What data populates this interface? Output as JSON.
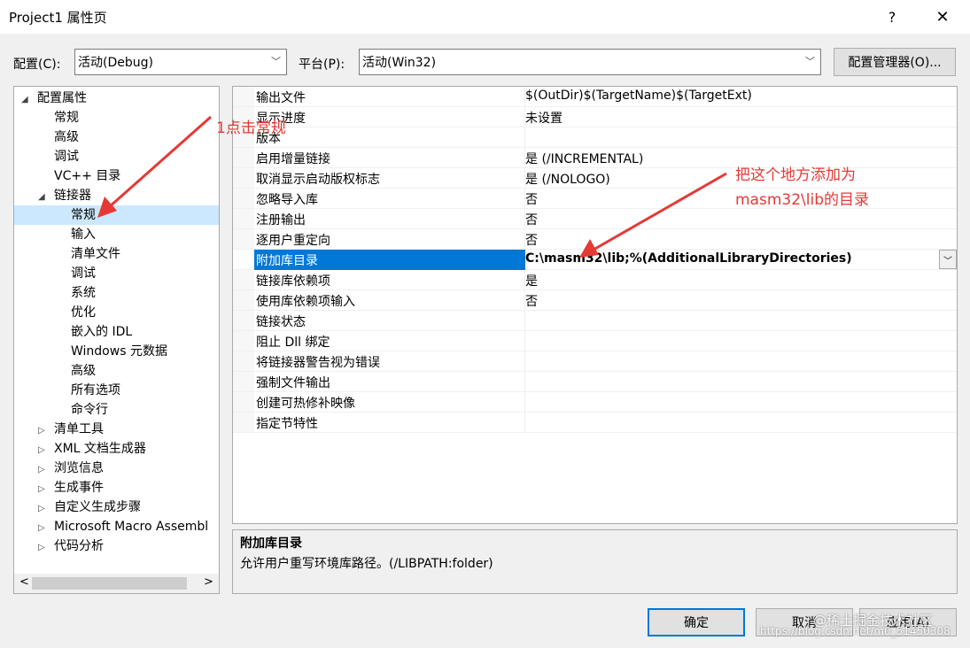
{
  "window": {
    "title": "Project1 属性页",
    "help": "?",
    "close": "✕"
  },
  "config": {
    "label": "配置(C):",
    "value": "活动(Debug)"
  },
  "platform": {
    "label": "平台(P):",
    "value": "活动(Win32)"
  },
  "config_manager_button": "配置管理器(O)...",
  "tree": [
    {
      "label": "配置属性",
      "toggle": "◢",
      "level": 0
    },
    {
      "label": "常规",
      "toggle": "",
      "level": 1
    },
    {
      "label": "高级",
      "toggle": "",
      "level": 1
    },
    {
      "label": "调试",
      "toggle": "",
      "level": 1
    },
    {
      "label": "VC++ 目录",
      "toggle": "",
      "level": 1
    },
    {
      "label": "链接器",
      "toggle": "◢",
      "level": 1
    },
    {
      "label": "常规",
      "toggle": "",
      "level": 2,
      "selected": true
    },
    {
      "label": "输入",
      "toggle": "",
      "level": 2
    },
    {
      "label": "清单文件",
      "toggle": "",
      "level": 2
    },
    {
      "label": "调试",
      "toggle": "",
      "level": 2
    },
    {
      "label": "系统",
      "toggle": "",
      "level": 2
    },
    {
      "label": "优化",
      "toggle": "",
      "level": 2
    },
    {
      "label": "嵌入的 IDL",
      "toggle": "",
      "level": 2
    },
    {
      "label": "Windows 元数据",
      "toggle": "",
      "level": 2
    },
    {
      "label": "高级",
      "toggle": "",
      "level": 2
    },
    {
      "label": "所有选项",
      "toggle": "",
      "level": 2
    },
    {
      "label": "命令行",
      "toggle": "",
      "level": 2
    },
    {
      "label": "清单工具",
      "toggle": "▷",
      "level": 1
    },
    {
      "label": "XML 文档生成器",
      "toggle": "▷",
      "level": 1
    },
    {
      "label": "浏览信息",
      "toggle": "▷",
      "level": 1
    },
    {
      "label": "生成事件",
      "toggle": "▷",
      "level": 1
    },
    {
      "label": "自定义生成步骤",
      "toggle": "▷",
      "level": 1
    },
    {
      "label": "Microsoft Macro Assembl",
      "toggle": "▷",
      "level": 1
    },
    {
      "label": "代码分析",
      "toggle": "▷",
      "level": 1
    }
  ],
  "tree_scroll": {
    "left": "<",
    "right": ">"
  },
  "properties": [
    {
      "key": "输出文件",
      "value": "$(OutDir)$(TargetName)$(TargetExt)"
    },
    {
      "key": "显示进度",
      "value": "未设置"
    },
    {
      "key": "版本",
      "value": ""
    },
    {
      "key": "启用增量链接",
      "value": "是 (/INCREMENTAL)"
    },
    {
      "key": "取消显示启动版权标志",
      "value": "是 (/NOLOGO)"
    },
    {
      "key": "忽略导入库",
      "value": "否"
    },
    {
      "key": "注册输出",
      "value": "否"
    },
    {
      "key": "逐用户重定向",
      "value": "否"
    },
    {
      "key": "附加库目录",
      "value": "C:\\masm32\\lib;%(AdditionalLibraryDirectories)",
      "selected": true
    },
    {
      "key": "链接库依赖项",
      "value": "是"
    },
    {
      "key": "使用库依赖项输入",
      "value": "否"
    },
    {
      "key": "链接状态",
      "value": ""
    },
    {
      "key": "阻止 Dll 绑定",
      "value": ""
    },
    {
      "key": "将链接器警告视为错误",
      "value": ""
    },
    {
      "key": "强制文件输出",
      "value": ""
    },
    {
      "key": "创建可热修补映像",
      "value": ""
    },
    {
      "key": "指定节特性",
      "value": ""
    }
  ],
  "description": {
    "title": "附加库目录",
    "text": "允许用户重写环境库路径。(/LIBPATH:folder)"
  },
  "buttons": {
    "ok": "确定",
    "cancel": "取消",
    "apply": "应用(A)"
  },
  "annotations": {
    "step1": "1点击常规",
    "step2_line1": "把这个地方添加为",
    "step2_line2": "masm32\\lib的目录"
  },
  "watermark": {
    "line1": "@稀土掘金技术社区",
    "line2": "https://blog.csdn.net/m0_51450308"
  },
  "colors": {
    "accent": "#0078d7",
    "annotation": "#e53935",
    "selection_tree": "#cce8ff"
  }
}
